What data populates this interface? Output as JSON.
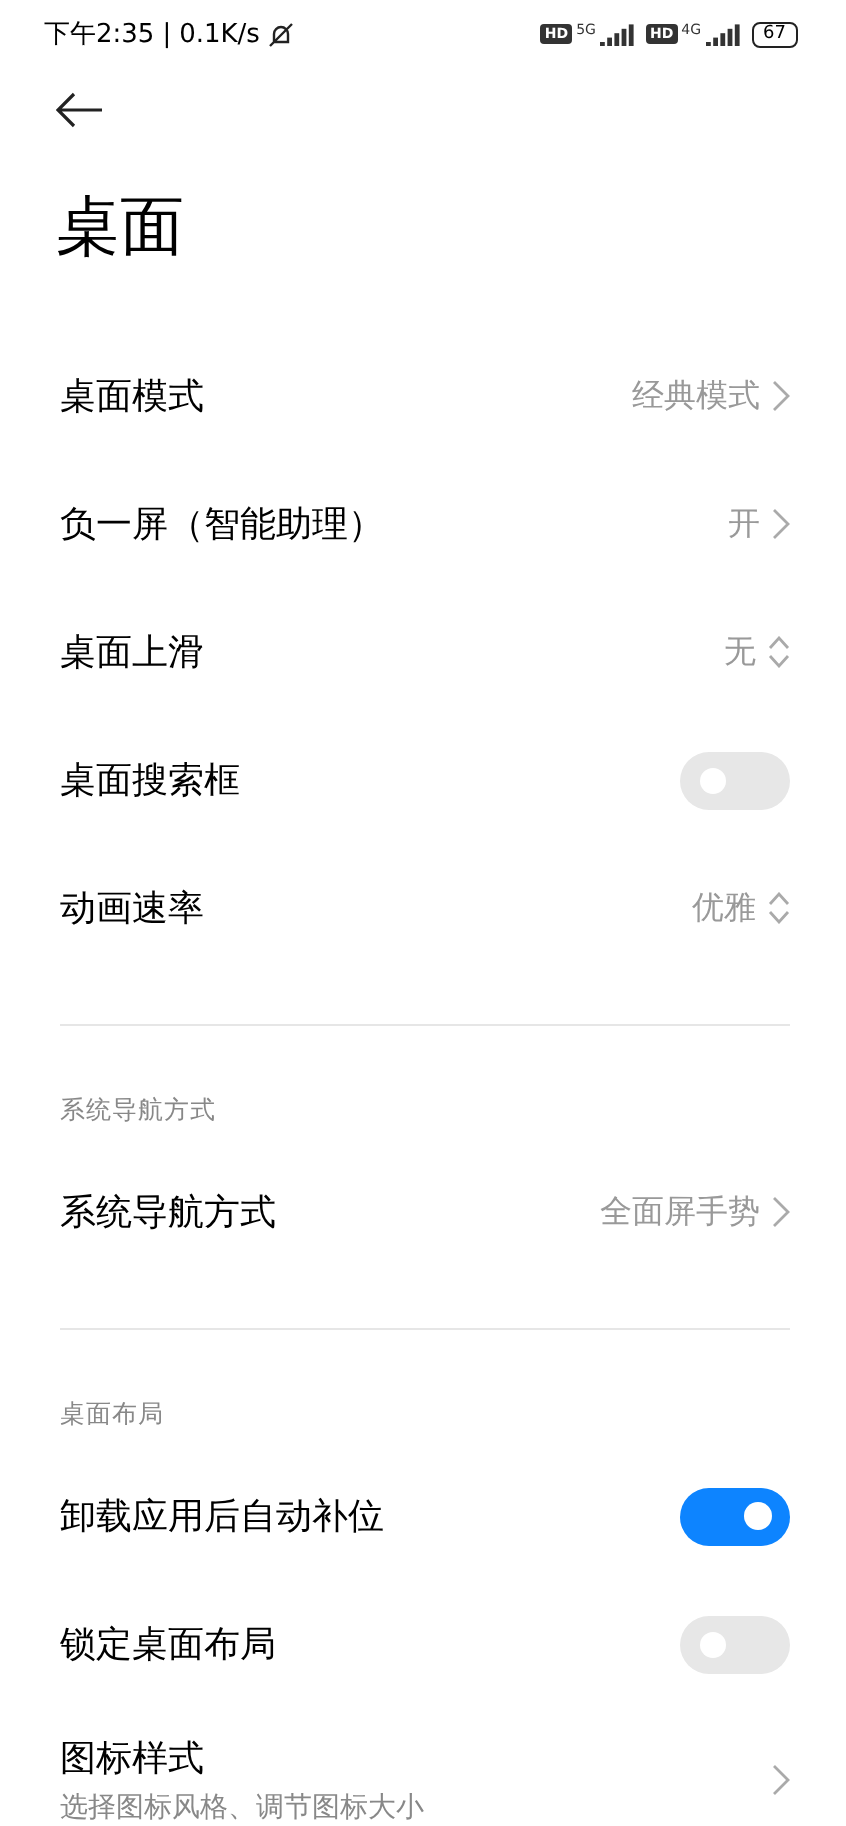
{
  "status_bar": {
    "time": "下午2:35",
    "separator": "|",
    "speed": "0.1K/s",
    "networks": [
      {
        "badge": "HD",
        "type": "5G"
      },
      {
        "badge": "HD",
        "type": "4G"
      }
    ],
    "battery": "67"
  },
  "title": "桌面",
  "sections": [
    {
      "rows": [
        {
          "kind": "link",
          "label": "桌面模式",
          "value": "经典模式"
        },
        {
          "kind": "link",
          "label": "负一屏（智能助理）",
          "value": "开"
        },
        {
          "kind": "picker",
          "label": "桌面上滑",
          "value": "无"
        },
        {
          "kind": "switch",
          "label": "桌面搜索框",
          "on": false
        },
        {
          "kind": "picker",
          "label": "动画速率",
          "value": "优雅"
        }
      ]
    },
    {
      "header": "系统导航方式",
      "rows": [
        {
          "kind": "link",
          "label": "系统导航方式",
          "value": "全面屏手势"
        }
      ]
    },
    {
      "header": "桌面布局",
      "rows": [
        {
          "kind": "switch",
          "label": "卸载应用后自动补位",
          "on": true
        },
        {
          "kind": "switch",
          "label": "锁定桌面布局",
          "on": false
        },
        {
          "kind": "link",
          "label": "图标样式",
          "subtitle": "选择图标风格、调节图标大小"
        }
      ]
    }
  ]
}
